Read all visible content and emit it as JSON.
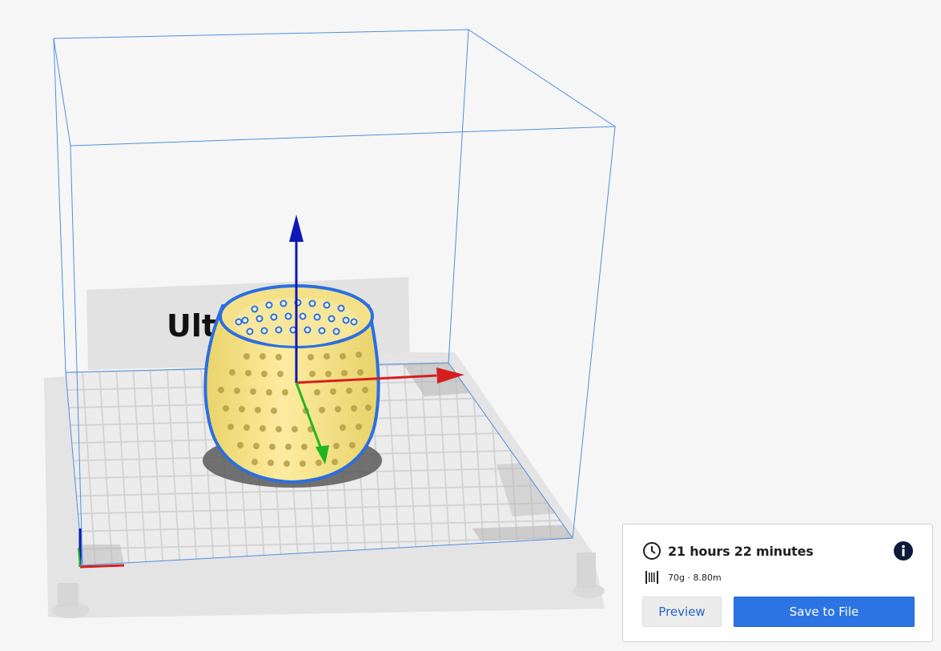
{
  "viewport": {
    "bed_label": "Ult"
  },
  "print_info": {
    "time": "21 hours 22 minutes",
    "material": "70g · 8.80m"
  },
  "actions": {
    "preview_label": "Preview",
    "save_label": "Save to File"
  },
  "colors": {
    "model": "#fbe98d",
    "model_outline": "#2a6fe0",
    "axis_x": "#d51f1f",
    "axis_y": "#1fb61f",
    "axis_z": "#0f18b4",
    "build_volume": "#4e8fe0",
    "accent": "#2c74e3"
  },
  "icons": {
    "time": "clock-icon",
    "material": "filament-spool-icon",
    "info": "info-icon"
  }
}
